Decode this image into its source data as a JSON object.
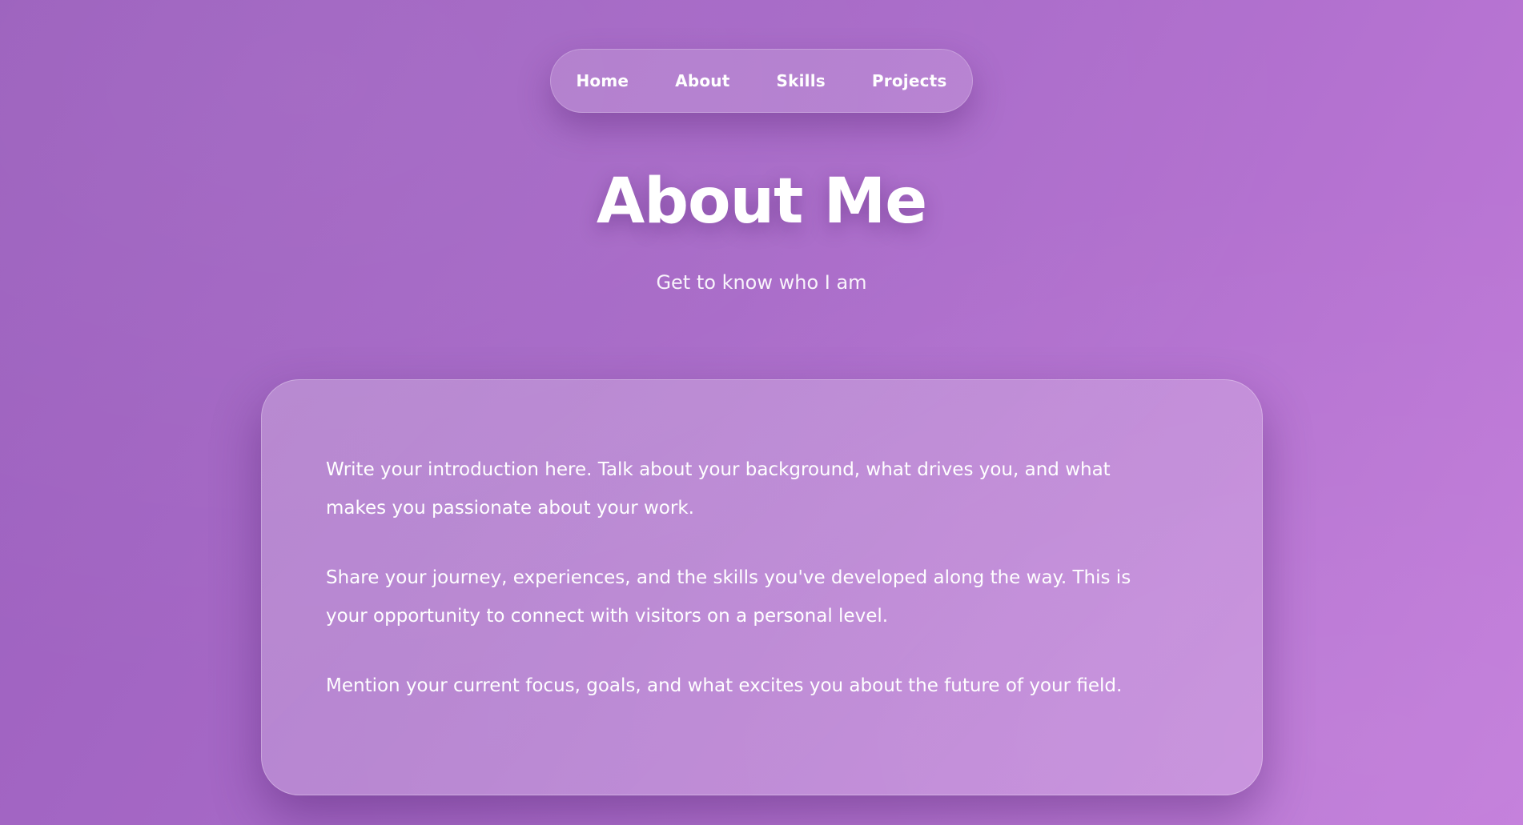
{
  "nav": {
    "items": [
      {
        "label": "Home"
      },
      {
        "label": "About"
      },
      {
        "label": "Skills"
      },
      {
        "label": "Projects"
      }
    ]
  },
  "hero": {
    "title": "About Me",
    "subtitle": "Get to know who I am"
  },
  "about": {
    "paragraphs": [
      "Write your introduction here. Talk about your background, what drives you, and what makes you passionate about your work.",
      "Share your journey, experiences, and the skills you've developed along the way. This is your opportunity to connect with visitors on a personal level.",
      "Mention your current focus, goals, and what excites you about the future of your field."
    ]
  },
  "colors": {
    "background_start": "#9b5fbd",
    "background_end": "#c27bda",
    "text": "#ffffff"
  }
}
